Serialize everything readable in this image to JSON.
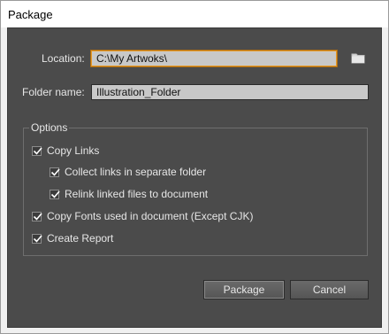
{
  "window": {
    "title": "Package"
  },
  "location": {
    "label": "Location:",
    "value": "C:\\My Artwoks\\"
  },
  "folder_name": {
    "label": "Folder name:",
    "value": "Illustration_Folder"
  },
  "options": {
    "legend": "Options",
    "items": [
      {
        "label": "Copy Links",
        "checked": true
      },
      {
        "label": "Collect links in separate folder",
        "checked": true
      },
      {
        "label": "Relink linked files to document",
        "checked": true
      },
      {
        "label": "Copy Fonts used in document (Except CJK)",
        "checked": true
      },
      {
        "label": "Create Report",
        "checked": true
      }
    ]
  },
  "buttons": {
    "package": "Package",
    "cancel": "Cancel"
  },
  "icons": {
    "browse": "folder-icon",
    "check": "checkmark-icon"
  },
  "colors": {
    "panel": "#4b4b4b",
    "focus": "#e79a27",
    "field": "#c8c8c8"
  }
}
